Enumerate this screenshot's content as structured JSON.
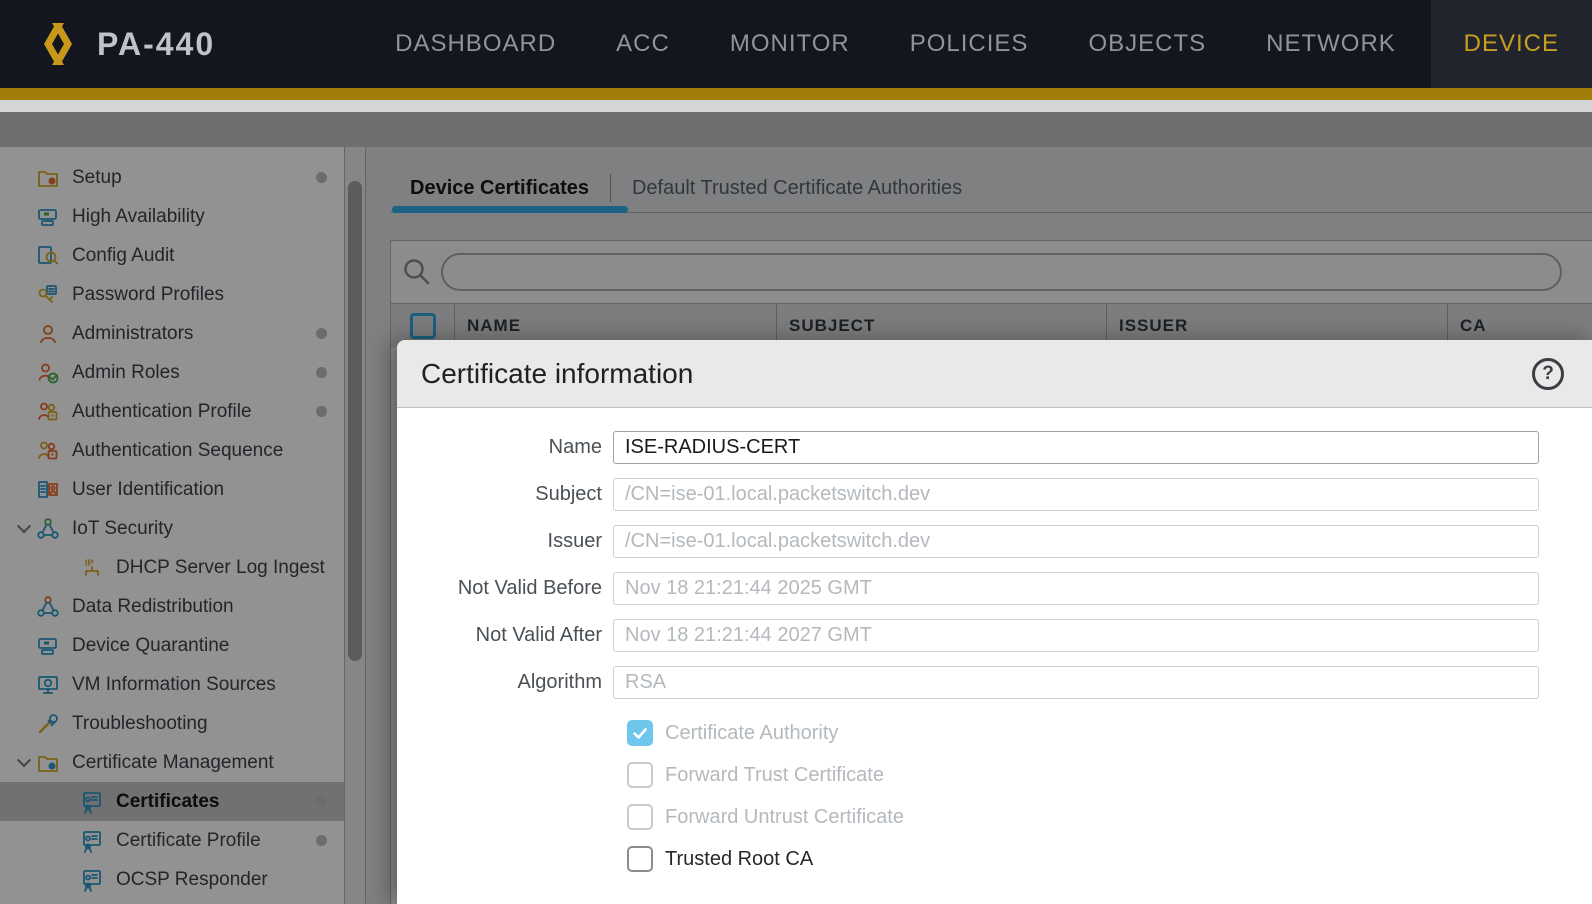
{
  "colors": {
    "nav_bg": "#13161f",
    "accent_gold_bar": "#a07d08",
    "nav_active_text": "#c99f1d",
    "tab_underline_blue": "#2ea3dc",
    "table_checkbox_blue": "#2f9ed5",
    "checkbox_checked_blue": "#6fc6ed"
  },
  "nav": {
    "brand": "PA-440",
    "logo_icon": "palo-alto-logo",
    "items": [
      {
        "label": "DASHBOARD",
        "active": false
      },
      {
        "label": "ACC",
        "active": false
      },
      {
        "label": "MONITOR",
        "active": false
      },
      {
        "label": "POLICIES",
        "active": false
      },
      {
        "label": "OBJECTS",
        "active": false
      },
      {
        "label": "NETWORK",
        "active": false
      },
      {
        "label": "DEVICE",
        "active": true
      }
    ]
  },
  "sidebar": {
    "items": [
      {
        "label": "Setup",
        "icon": "setup-icon",
        "shape": "folder",
        "c1": "#c9a227",
        "c2": "#e0662e",
        "dot": true,
        "level": 0,
        "chevron": false,
        "selected": false
      },
      {
        "label": "High Availability",
        "icon": "high-availability-icon",
        "shape": "cards",
        "c1": "#2e8fc0",
        "c2": "#4aa64a",
        "dot": false,
        "level": 0,
        "chevron": false,
        "selected": false
      },
      {
        "label": "Config Audit",
        "icon": "config-audit-icon",
        "shape": "docsearch",
        "c1": "#2e8fc0",
        "c2": "#c9a227",
        "dot": false,
        "level": 0,
        "chevron": false,
        "selected": false
      },
      {
        "label": "Password Profiles",
        "icon": "password-profiles-icon",
        "shape": "key",
        "c1": "#c9a227",
        "c2": "#2e8fc0",
        "dot": false,
        "level": 0,
        "chevron": false,
        "selected": false
      },
      {
        "label": "Administrators",
        "icon": "administrators-icon",
        "shape": "person",
        "c1": "#e0662e",
        "c2": "#e0662e",
        "dot": true,
        "level": 0,
        "chevron": false,
        "selected": false
      },
      {
        "label": "Admin Roles",
        "icon": "admin-roles-icon",
        "shape": "personcheck",
        "c1": "#e0662e",
        "c2": "#4aa64a",
        "dot": true,
        "level": 0,
        "chevron": false,
        "selected": false
      },
      {
        "label": "Authentication Profile",
        "icon": "authentication-profile-icon",
        "shape": "peoplelock",
        "c1": "#c9a227",
        "c2": "#e0662e",
        "dot": true,
        "level": 0,
        "chevron": false,
        "selected": false
      },
      {
        "label": "Authentication Sequence",
        "icon": "authentication-sequence-icon",
        "shape": "peoplelock",
        "c1": "#e0662e",
        "c2": "#c9a227",
        "dot": false,
        "level": 0,
        "chevron": false,
        "selected": false
      },
      {
        "label": "User Identification",
        "icon": "user-identification-icon",
        "shape": "listperson",
        "c1": "#2e8fc0",
        "c2": "#e0662e",
        "dot": false,
        "level": 0,
        "chevron": false,
        "selected": false
      },
      {
        "label": "IoT Security",
        "icon": "iot-security-icon",
        "shape": "nodes",
        "c1": "#2e8fc0",
        "c2": "#4aa64a",
        "dot": false,
        "level": 0,
        "chevron": true,
        "selected": false
      },
      {
        "label": "DHCP Server Log Ingest",
        "icon": "dhcp-server-log-ingestion-icon",
        "shape": "ip",
        "c1": "#c9a227",
        "c2": "#c9a227",
        "dot": false,
        "level": 1,
        "chevron": false,
        "selected": false
      },
      {
        "label": "Data Redistribution",
        "icon": "data-redistribution-icon",
        "shape": "nodes",
        "c1": "#2e8fc0",
        "c2": "#e0662e",
        "dot": false,
        "level": 0,
        "chevron": false,
        "selected": false
      },
      {
        "label": "Device Quarantine",
        "icon": "device-quarantine-icon",
        "shape": "cards",
        "c1": "#2e8fc0",
        "c2": "#2e8fc0",
        "dot": false,
        "level": 0,
        "chevron": false,
        "selected": false
      },
      {
        "label": "VM Information Sources",
        "icon": "vm-information-sources-icon",
        "shape": "screen",
        "c1": "#2e8fc0",
        "c2": "#2e8fc0",
        "dot": false,
        "level": 0,
        "chevron": false,
        "selected": false
      },
      {
        "label": "Troubleshooting",
        "icon": "troubleshooting-icon",
        "shape": "tools",
        "c1": "#2e8fc0",
        "c2": "#c9a227",
        "dot": false,
        "level": 0,
        "chevron": false,
        "selected": false
      },
      {
        "label": "Certificate Management",
        "icon": "certificate-management-icon",
        "shape": "folder",
        "c1": "#c9a227",
        "c2": "#2e8fc0",
        "dot": false,
        "level": 0,
        "chevron": true,
        "selected": false
      },
      {
        "label": "Certificates",
        "icon": "certificates-icon",
        "shape": "cert",
        "c1": "#2e8fc0",
        "c2": "#2e8fc0",
        "dot": true,
        "level": 1,
        "chevron": false,
        "selected": true
      },
      {
        "label": "Certificate Profile",
        "icon": "certificate-profile-icon",
        "shape": "cert",
        "c1": "#2e8fc0",
        "c2": "#2e8fc0",
        "dot": true,
        "level": 1,
        "chevron": false,
        "selected": false
      },
      {
        "label": "OCSP Responder",
        "icon": "ocsp-responder-icon",
        "shape": "cert",
        "c1": "#2e8fc0",
        "c2": "#4aa64a",
        "dot": false,
        "level": 1,
        "chevron": false,
        "selected": false
      }
    ]
  },
  "content": {
    "tabs": [
      {
        "label": "Device Certificates",
        "active": true
      },
      {
        "label": "Default Trusted Certificate Authorities",
        "active": false
      }
    ],
    "search": {
      "value": "",
      "placeholder": "",
      "icon": "search-icon"
    },
    "table": {
      "columns": [
        "NAME",
        "SUBJECT",
        "ISSUER",
        "CA"
      ]
    }
  },
  "modal": {
    "title": "Certificate information",
    "help_icon": "?",
    "fields": [
      {
        "label": "Name",
        "value": "ISE-RADIUS-CERT",
        "disabled": false
      },
      {
        "label": "Subject",
        "value": "/CN=ise-01.local.packetswitch.dev",
        "disabled": true
      },
      {
        "label": "Issuer",
        "value": "/CN=ise-01.local.packetswitch.dev",
        "disabled": true
      },
      {
        "label": "Not Valid Before",
        "value": "Nov 18 21:21:44 2025 GMT",
        "disabled": true
      },
      {
        "label": "Not Valid After",
        "value": "Nov 18 21:21:44 2027 GMT",
        "disabled": true
      },
      {
        "label": "Algorithm",
        "value": "RSA",
        "disabled": true
      }
    ],
    "checkboxes": [
      {
        "label": "Certificate Authority",
        "checked": true,
        "disabled": true
      },
      {
        "label": "Forward Trust Certificate",
        "checked": false,
        "disabled": true
      },
      {
        "label": "Forward Untrust Certificate",
        "checked": false,
        "disabled": true
      },
      {
        "label": "Trusted Root CA",
        "checked": false,
        "disabled": false
      }
    ]
  }
}
